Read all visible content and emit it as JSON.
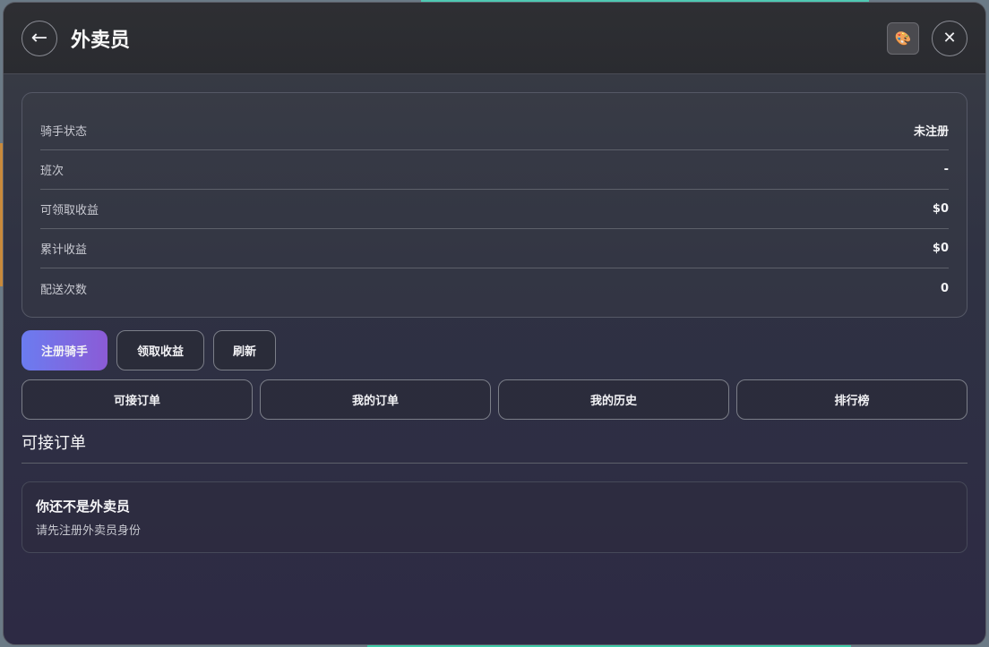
{
  "header": {
    "title": "外卖员",
    "back_icon": "←",
    "theme_icon": "🎨",
    "close_icon": "✕"
  },
  "info": [
    {
      "label": "骑手状态",
      "value": "未注册"
    },
    {
      "label": "班次",
      "value": "-"
    },
    {
      "label": "可领取收益",
      "value": "$0"
    },
    {
      "label": "累计收益",
      "value": "$0"
    },
    {
      "label": "配送次数",
      "value": "0"
    }
  ],
  "actions": {
    "register": "注册骑手",
    "collect": "领取收益",
    "refresh": "刷新"
  },
  "tabs": [
    "可接订单",
    "我的订单",
    "我的历史",
    "排行榜"
  ],
  "section": {
    "title": "可接订单"
  },
  "empty": {
    "title": "你还不是外卖员",
    "subtitle": "请先注册外卖员身份"
  },
  "colors": {
    "primary_gradient_start": "#6b7cf0",
    "primary_gradient_end": "#8b5bd6"
  }
}
